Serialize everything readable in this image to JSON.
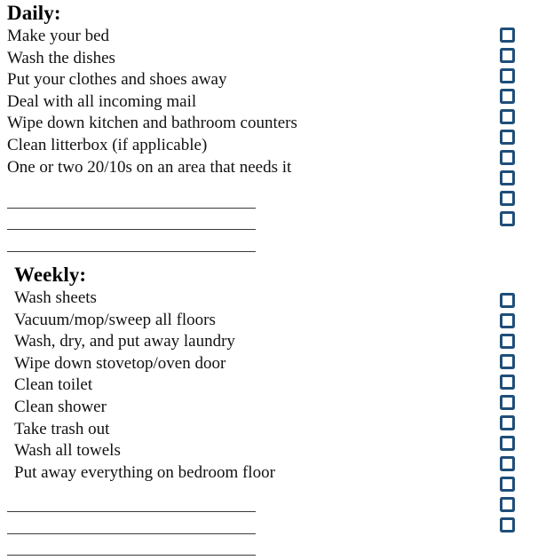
{
  "document": {
    "type": "printable-chore-checklist",
    "background_color": "#ffffff",
    "text_color": "#111111",
    "checkbox_color": "#1f4e79",
    "rule_color": "#3a3a3a"
  },
  "sections": [
    {
      "id": "daily",
      "heading": "Daily:",
      "tasks": [
        "Make your bed",
        "Wash the dishes",
        "Put your clothes and shoes away",
        "Deal with all incoming mail",
        "Wipe down kitchen and bathroom counters",
        "Clean litterbox (if applicable)",
        "One or two 20/10s on an area that needs it"
      ],
      "blank_lines": 3,
      "checkbox_count": 10
    },
    {
      "id": "weekly",
      "heading": "Weekly:",
      "tasks": [
        "Wash sheets",
        "Vacuum/mop/sweep all floors",
        "Wash, dry, and put away laundry",
        "Wipe down stovetop/oven door",
        "Clean toilet",
        "Clean shower",
        "Take trash out",
        "Wash all towels",
        "Put away everything on bedroom floor"
      ],
      "blank_lines": 3,
      "checkbox_count": 12
    }
  ]
}
